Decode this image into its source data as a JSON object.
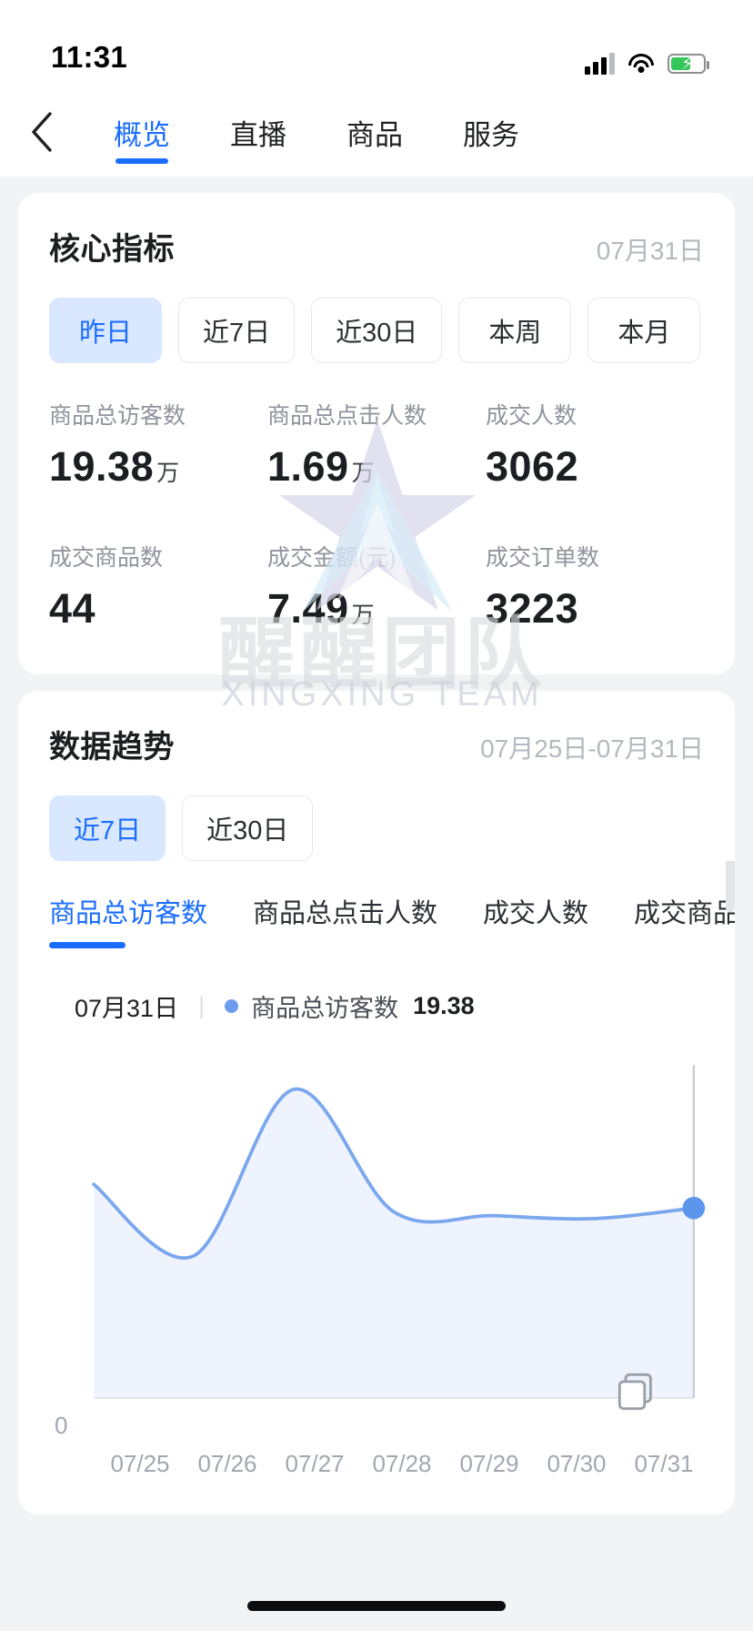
{
  "status_bar": {
    "time": "11:31",
    "signal_icon": "cellular-signal-icon",
    "wifi_icon": "wifi-icon",
    "battery_icon": "battery-charging-icon"
  },
  "nav": {
    "back_icon": "back-chevron-icon",
    "tabs": [
      {
        "label": "概览",
        "active": true
      },
      {
        "label": "直播",
        "active": false
      },
      {
        "label": "商品",
        "active": false
      },
      {
        "label": "服务",
        "active": false
      }
    ]
  },
  "core_metrics": {
    "title": "核心指标",
    "date": "07月31日",
    "filters": [
      {
        "label": "昨日",
        "active": true
      },
      {
        "label": "近7日",
        "active": false
      },
      {
        "label": "近30日",
        "active": false
      },
      {
        "label": "本周",
        "active": false
      },
      {
        "label": "本月",
        "active": false
      }
    ],
    "items": [
      {
        "label": "商品总访客数",
        "value": "19.38",
        "unit": "万"
      },
      {
        "label": "商品总点击人数",
        "value": "1.69",
        "unit": "万"
      },
      {
        "label": "成交人数",
        "value": "3062",
        "unit": ""
      },
      {
        "label": "成交商品数",
        "value": "44",
        "unit": ""
      },
      {
        "label": "成交金额(元)",
        "value": "7.49",
        "unit": "万"
      },
      {
        "label": "成交订单数",
        "value": "3223",
        "unit": ""
      }
    ]
  },
  "trend": {
    "title": "数据趋势",
    "date_range": "07月25日-07月31日",
    "filters": [
      {
        "label": "近7日",
        "active": true
      },
      {
        "label": "近30日",
        "active": false
      }
    ],
    "metric_tabs": [
      {
        "label": "商品总访客数",
        "active": true
      },
      {
        "label": "商品总点击人数",
        "active": false
      },
      {
        "label": "成交人数",
        "active": false
      },
      {
        "label": "成交商品数",
        "active": false
      }
    ],
    "tooltip": {
      "date": "07月31日",
      "separator": "|",
      "series_name": "商品总访客数",
      "value": "19.38"
    },
    "save_icon": "save-image-icon"
  },
  "chart_data": {
    "type": "line",
    "title": "商品总访客数",
    "categories": [
      "07/25",
      "07/26",
      "07/27",
      "07/28",
      "07/29",
      "07/30",
      "07/31"
    ],
    "values": [
      21.8,
      14.5,
      31.5,
      19.0,
      18.6,
      18.3,
      19.38
    ],
    "series": [
      {
        "name": "商品总访客数",
        "values": [
          21.8,
          14.5,
          31.5,
          19.0,
          18.6,
          18.3,
          19.38
        ]
      }
    ],
    "xlabel": "",
    "ylabel": "",
    "ylim": [
      0,
      34
    ],
    "yticks": [
      "0"
    ],
    "grid": false,
    "legend": "top-left",
    "highlighted_point": {
      "category": "07/31",
      "value": 19.38
    },
    "line_color": "#7aa7ee",
    "area_fill": "#eef3fd",
    "smoothing": "spline"
  },
  "watermark": {
    "chinese": "醒醒团队",
    "english": "XINGXING TEAM",
    "logo_icon": "star-logo-icon"
  },
  "colors": {
    "accent": "#1a6dff",
    "chip_active_bg": "#d9e7ff",
    "page_bg": "#f2f3f5",
    "card_bg": "#ffffff",
    "muted_text": "#8f949c",
    "chart_line": "#7aa7ee"
  },
  "home_indicator": "home-indicator"
}
